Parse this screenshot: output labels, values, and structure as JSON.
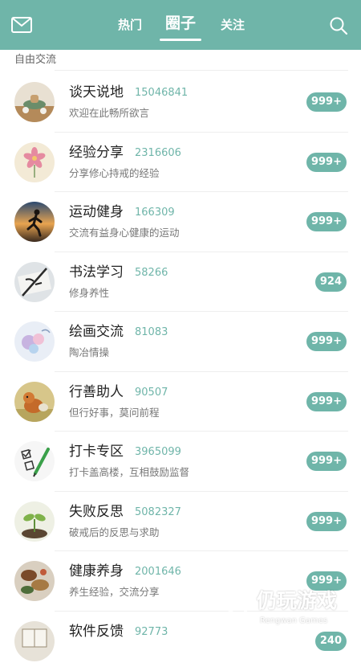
{
  "header": {
    "tabs": [
      {
        "label": "热门"
      },
      {
        "label": "圈子"
      },
      {
        "label": "关注"
      }
    ]
  },
  "section": {
    "label": "自由交流"
  },
  "groups": [
    {
      "name": "谈天说地",
      "count": "15046841",
      "desc": "欢迎在此畅所欲言",
      "badge": "999+",
      "avatar_icon": "tea-set-icon"
    },
    {
      "name": "经验分享",
      "count": "2316606",
      "desc": "分享修心持戒的经验",
      "badge": "999+",
      "avatar_icon": "flower-icon"
    },
    {
      "name": "运动健身",
      "count": "166309",
      "desc": "交流有益身心健康的运动",
      "badge": "999+",
      "avatar_icon": "runner-icon"
    },
    {
      "name": "书法学习",
      "count": "58266",
      "desc": "修身养性",
      "badge": "924",
      "avatar_icon": "calligraphy-icon"
    },
    {
      "name": "绘画交流",
      "count": "81083",
      "desc": "陶冶情操",
      "badge": "999+",
      "avatar_icon": "painting-icon"
    },
    {
      "name": "行善助人",
      "count": "90507",
      "desc": "但行好事，莫问前程",
      "badge": "999+",
      "avatar_icon": "dog-icon"
    },
    {
      "name": "打卡专区",
      "count": "3965099",
      "desc": "打卡盖高楼，互相鼓励监督",
      "badge": "999+",
      "avatar_icon": "checklist-icon"
    },
    {
      "name": "失败反思",
      "count": "5082327",
      "desc": "破戒后的反思与求助",
      "badge": "999+",
      "avatar_icon": "sprout-icon"
    },
    {
      "name": "健康养身",
      "count": "2001646",
      "desc": "养生经验，交流分享",
      "badge": "999+",
      "avatar_icon": "herbs-icon"
    },
    {
      "name": "软件反馈",
      "count": "92773",
      "desc": "",
      "badge": "240",
      "avatar_icon": "book-icon"
    }
  ],
  "watermark": {
    "text": "仍玩游戏",
    "sub": "Rengwan Games"
  },
  "colors": {
    "accent": "#6fb5a9",
    "text": "#222222",
    "muted": "#777777"
  }
}
